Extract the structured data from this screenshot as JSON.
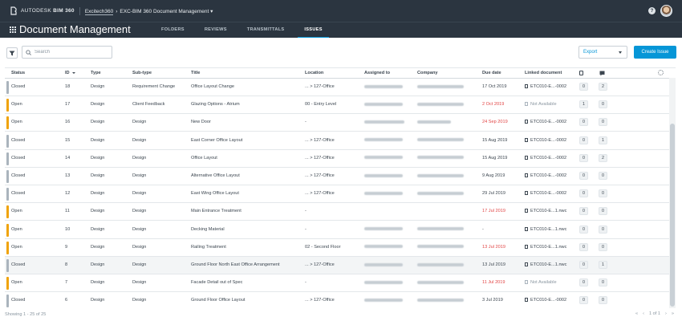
{
  "topbar": {
    "brand_prefix": "AUTODESK",
    "brand_product": "BIM 360",
    "hub": "Excitech360",
    "project": "EXC-BIM 360 Document Management",
    "help_label": "?"
  },
  "app": {
    "title": "Document Management",
    "tabs": [
      {
        "label": "FOLDERS",
        "active": false
      },
      {
        "label": "REVIEWS",
        "active": false
      },
      {
        "label": "TRANSMITTALS",
        "active": false
      },
      {
        "label": "ISSUES",
        "active": true
      }
    ]
  },
  "toolbar": {
    "search_placeholder": "Search",
    "export_label": "Export",
    "create_label": "Create Issue"
  },
  "colors": {
    "open": "#f0a30a",
    "closed": "#aab4bd",
    "accent": "#0696d7",
    "overdue": "#e24545"
  },
  "table": {
    "columns": [
      {
        "label": "Status",
        "sort": false
      },
      {
        "label": "ID",
        "sort": true
      },
      {
        "label": "Type",
        "sort": false
      },
      {
        "label": "Sub-type",
        "sort": false
      },
      {
        "label": "Title",
        "sort": false
      },
      {
        "label": "Location",
        "sort": false
      },
      {
        "label": "Assigned to",
        "sort": false
      },
      {
        "label": "Company",
        "sort": false
      },
      {
        "label": "Due date",
        "sort": false
      },
      {
        "label": "Linked document",
        "sort": false
      }
    ],
    "header_icons": [
      "document-icon",
      "comment-icon",
      "settings-gear-icon"
    ],
    "rows": [
      {
        "status": "Closed",
        "id": "18",
        "type": "Design",
        "subtype": "Requirement Change",
        "title": "Office Layout Change",
        "location": "... > 127-Office",
        "due": "17 Oct 2019",
        "overdue": false,
        "doc": "ETC010-E...-0002",
        "doc_available": true,
        "attachments": "0",
        "comments": "2"
      },
      {
        "status": "Open",
        "id": "17",
        "type": "Design",
        "subtype": "Client Feedback",
        "title": "Glazing Options - Atrium",
        "location": "00 - Entry Level",
        "due": "2 Oct 2019",
        "overdue": true,
        "doc": "Not Available",
        "doc_available": false,
        "attachments": "1",
        "comments": "0"
      },
      {
        "status": "Open",
        "id": "16",
        "type": "Design",
        "subtype": "Design",
        "title": "New Door",
        "location": "-",
        "due": "24 Sep 2019",
        "overdue": true,
        "doc": "ETC010-E...-0002",
        "doc_available": true,
        "attachments": "0",
        "comments": "0"
      },
      {
        "status": "Closed",
        "id": "15",
        "type": "Design",
        "subtype": "Design",
        "title": "East Corner Office Layout",
        "location": "... > 127-Office",
        "due": "15 Aug 2019",
        "overdue": false,
        "doc": "ETC010-E...-0002",
        "doc_available": true,
        "attachments": "0",
        "comments": "1"
      },
      {
        "status": "Closed",
        "id": "14",
        "type": "Design",
        "subtype": "Design",
        "title": "Office Layout",
        "location": "... > 127-Office",
        "due": "15 Aug 2019",
        "overdue": false,
        "doc": "ETC010-E...-0002",
        "doc_available": true,
        "attachments": "0",
        "comments": "2"
      },
      {
        "status": "Closed",
        "id": "13",
        "type": "Design",
        "subtype": "Design",
        "title": "Alternative Office Layout",
        "location": "... > 127-Office",
        "due": "9 Aug 2019",
        "overdue": false,
        "doc": "ETC010-E...-0002",
        "doc_available": true,
        "attachments": "0",
        "comments": "0"
      },
      {
        "status": "Closed",
        "id": "12",
        "type": "Design",
        "subtype": "Design",
        "title": "East Wing Office Layout",
        "location": "... > 127-Office",
        "due": "29 Jul 2019",
        "overdue": false,
        "doc": "ETC010-E...-0002",
        "doc_available": true,
        "attachments": "0",
        "comments": "0"
      },
      {
        "status": "Open",
        "id": "11",
        "type": "Design",
        "subtype": "Design",
        "title": "Main Entrance Treatment",
        "location": "-",
        "due": "17 Jul 2019",
        "overdue": true,
        "doc": "ETC010-E...1.nwc",
        "doc_available": true,
        "attachments": "0",
        "comments": "0"
      },
      {
        "status": "Open",
        "id": "10",
        "type": "Design",
        "subtype": "Design",
        "title": "Decking Material",
        "location": "-",
        "due": "-",
        "overdue": false,
        "doc": "ETC010-E...1.nwc",
        "doc_available": true,
        "attachments": "0",
        "comments": "0"
      },
      {
        "status": "Open",
        "id": "9",
        "type": "Design",
        "subtype": "Design",
        "title": "Railing Treatment",
        "location": "02 - Second Floor",
        "due": "13 Jul 2019",
        "overdue": true,
        "doc": "ETC010-E...1.nwc",
        "doc_available": true,
        "attachments": "0",
        "comments": "0"
      },
      {
        "status": "Closed",
        "id": "8",
        "type": "Design",
        "subtype": "Design",
        "title": "Ground Floor North East Office Arrangement",
        "location": "... > 127-Office",
        "due": "13 Jul 2019",
        "overdue": false,
        "doc": "ETC010-E...1.nwc",
        "doc_available": true,
        "attachments": "0",
        "comments": "1"
      },
      {
        "status": "Open",
        "id": "7",
        "type": "Design",
        "subtype": "Design",
        "title": "Facade Detail out of Spec",
        "location": "-",
        "due": "11 Jul 2019",
        "overdue": true,
        "doc": "Not Available",
        "doc_available": false,
        "attachments": "0",
        "comments": "0"
      },
      {
        "status": "Closed",
        "id": "6",
        "type": "Design",
        "subtype": "Design",
        "title": "Ground Floor Office Layout",
        "location": "... > 127-Office",
        "due": "3 Jul 2019",
        "overdue": false,
        "doc": "ETC010-E...-0002",
        "doc_available": true,
        "attachments": "0",
        "comments": "0"
      }
    ]
  },
  "footer": {
    "showing": "Showing 1 - 25 of 25",
    "page": "1 of 1"
  }
}
